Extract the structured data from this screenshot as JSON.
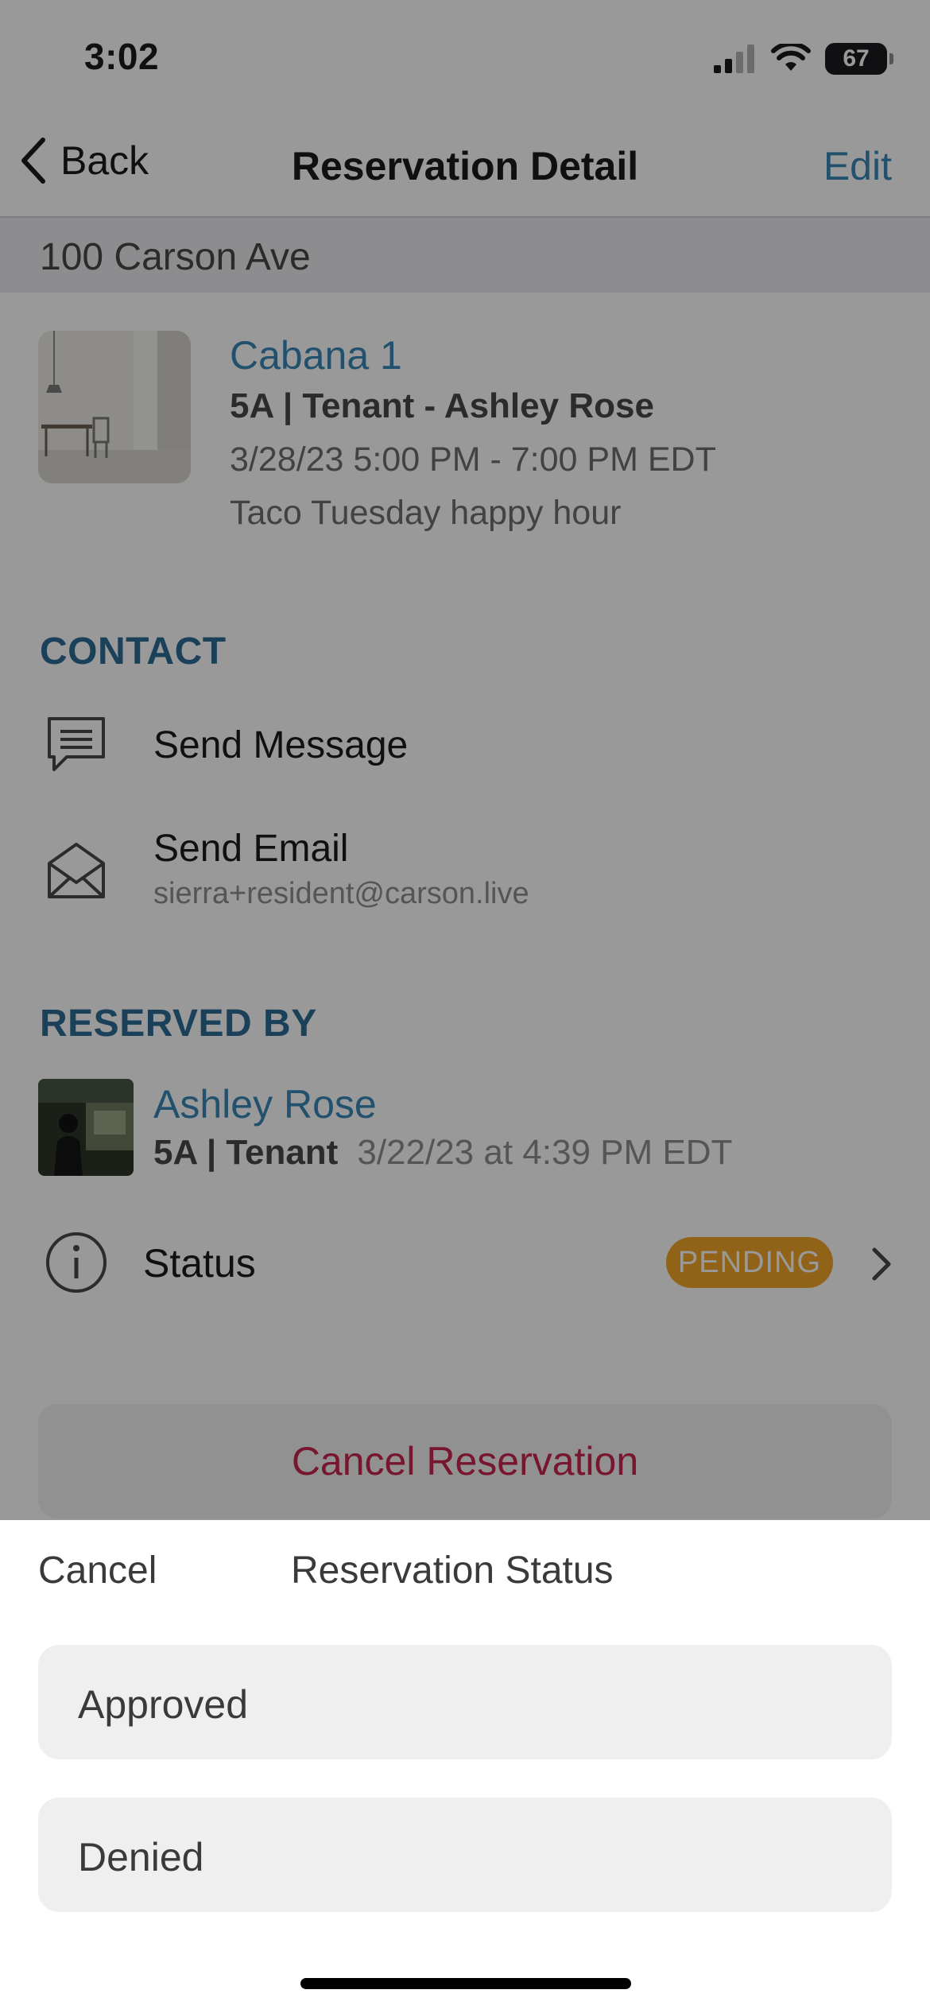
{
  "status_bar": {
    "time": "3:02",
    "battery": "67",
    "icons": [
      "cellular-signal-icon",
      "wifi-icon",
      "battery-icon"
    ]
  },
  "nav": {
    "back_label": "Back",
    "title": "Reservation Detail",
    "edit_label": "Edit"
  },
  "building": {
    "address": "100 Carson Ave"
  },
  "reservation": {
    "amenity": "Cabana 1",
    "unit_tenant": "5A | Tenant - Ashley Rose",
    "time": "3/28/23 5:00 PM - 7:00 PM EDT",
    "note": "Taco Tuesday happy hour"
  },
  "contact": {
    "heading": "CONTACT",
    "message_label": "Send Message",
    "email_label": "Send Email",
    "email_address": "sierra+resident@carson.live"
  },
  "reserved_by": {
    "heading": "RESERVED BY",
    "name": "Ashley Rose",
    "unit": "5A | Tenant",
    "date": "3/22/23 at 4:39 PM EDT"
  },
  "status": {
    "label": "Status",
    "value": "PENDING",
    "badge_color": "#f0a52a"
  },
  "cancel_reservation_label": "Cancel Reservation",
  "sheet": {
    "cancel_label": "Cancel",
    "title": "Reservation Status",
    "options": [
      "Approved",
      "Denied"
    ]
  },
  "colors": {
    "accent": "#3a88b8",
    "danger": "#c7254e",
    "section_heading": "#2e6d96"
  }
}
